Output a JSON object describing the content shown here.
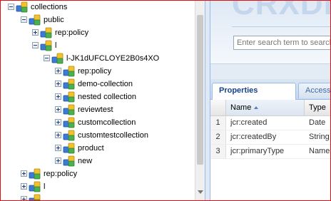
{
  "tree": {
    "nodes": [
      {
        "label": "collections",
        "expanded": true
      },
      {
        "label": "public",
        "expanded": true
      },
      {
        "label": "rep:policy",
        "expanded": false
      },
      {
        "label": "l",
        "expanded": true
      },
      {
        "label": "l-JK1dUFCLOYE2B0s4XO",
        "expanded": true
      },
      {
        "label": "rep:policy",
        "expanded": false
      },
      {
        "label": "demo-collection",
        "expanded": false
      },
      {
        "label": "nested collection",
        "expanded": false
      },
      {
        "label": "reviewtest",
        "expanded": false
      },
      {
        "label": "customcollection",
        "expanded": false
      },
      {
        "label": "customtestcollection",
        "expanded": false
      },
      {
        "label": "product",
        "expanded": false
      },
      {
        "label": "new",
        "expanded": false
      },
      {
        "label": "rep:policy",
        "expanded": false
      },
      {
        "label": "l",
        "expanded": false
      },
      {
        "label": "",
        "expanded": false
      }
    ]
  },
  "header": {
    "logo_text": "CRXDE",
    "search_placeholder": "Enter search term to search"
  },
  "tabs": [
    {
      "label": "Properties",
      "active": true
    },
    {
      "label": "Access",
      "active": false
    }
  ],
  "grid": {
    "columns": [
      "Name",
      "Type"
    ],
    "rows": [
      {
        "num": "1",
        "name": "jcr:created",
        "type": "Date"
      },
      {
        "num": "2",
        "name": "jcr:createdBy",
        "type": "String"
      },
      {
        "num": "3",
        "name": "jcr:primaryType",
        "type": "Name"
      }
    ]
  },
  "colors": {
    "frame_border": "#e01010",
    "tab_text": "#15428b",
    "panel_border": "#99bbe8"
  }
}
